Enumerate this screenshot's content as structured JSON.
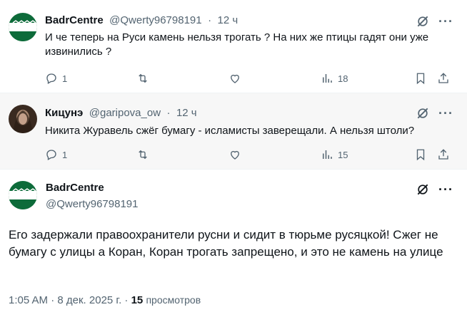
{
  "replies": [
    {
      "name": "BadrCentre",
      "handle": "@Qwerty96798191",
      "separator": "·",
      "time": "12 ч",
      "text": "И че теперь на Руси камень нельзя трогать ? На них же птицы гадят они уже извинились ?",
      "reply_count": "1",
      "retweet_count": "",
      "like_count": "",
      "views": "18",
      "avatar_colors": [
        "#0d6b3a",
        "#ffffff"
      ]
    },
    {
      "name": "Кицунэ",
      "handle": "@garipova_ow",
      "separator": "·",
      "time": "12 ч",
      "text": "Никита Журавель сжёг бумагу - исламисты заверещали. А нельзя штоли?",
      "reply_count": "1",
      "retweet_count": "",
      "like_count": "",
      "views": "15",
      "avatar_colors": [
        "#3a2a20",
        "#a88770"
      ]
    }
  ],
  "main_tweet": {
    "name": "BadrCentre",
    "handle": "@Qwerty96798191",
    "text": "Его задержали правоохранители русни и сидит в тюрьме русяцкой! Сжег не бумагу с улицы а Коран, Коран трогать запрещено, и это не камень на улице",
    "time": "1:05 AM",
    "date": "8 дек. 2025 г.",
    "separator": "·",
    "views_count": "15",
    "views_label": "просмотров"
  },
  "icons": {
    "reply": "reply-icon",
    "retweet": "retweet-icon",
    "like": "heart-icon",
    "views": "views-chart-icon",
    "bookmark": "bookmark-icon",
    "share": "share-icon",
    "grok": "grok-icon",
    "more": "more-icon"
  },
  "more_glyph": "···"
}
